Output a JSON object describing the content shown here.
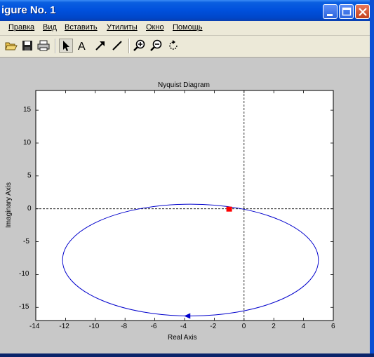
{
  "window": {
    "title": "igure No. 1"
  },
  "menu": [
    "Правка",
    "Вид",
    "Вставить",
    "Утилиты",
    "Окно",
    "Помощь"
  ],
  "toolbar": {
    "buttons": [
      "open-icon",
      "save-icon",
      "print-icon",
      "arrow-select-icon",
      "text-icon",
      "arrow-icon",
      "line-icon",
      "zoom-in-icon",
      "zoom-out-icon",
      "rotate-icon"
    ],
    "text_tool_glyph": "A"
  },
  "chart_data": {
    "type": "line",
    "title": "Nyquist Diagram",
    "xlabel": "Real Axis",
    "ylabel": "Imaginary Axis",
    "xlim": [
      -14,
      6
    ],
    "ylim": [
      -17,
      18
    ],
    "xticks": [
      -14,
      -12,
      -10,
      -8,
      -6,
      -4,
      -2,
      0,
      2,
      4,
      6
    ],
    "yticks": [
      -15,
      -10,
      -5,
      0,
      5,
      10,
      15
    ],
    "curve": {
      "shape": "ellipse",
      "center": [
        -3.6,
        -7.8
      ],
      "semi_axis_x": 8.6,
      "semi_axis_y": 8.5,
      "color": "#0000cc"
    },
    "arrow_at": [
      -3.8,
      -16.3
    ],
    "critical_point": {
      "x": -1,
      "y": 0,
      "color": "#ff0000"
    },
    "reference_lines": {
      "x": 0,
      "y": 0,
      "style": "dashed"
    }
  }
}
